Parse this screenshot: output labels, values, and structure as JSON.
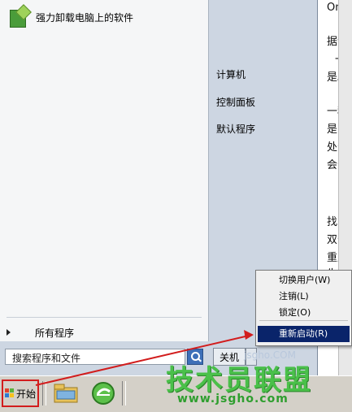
{
  "background_doc": {
    "lines": [
      {
        "text": "Oms么"
      },
      {
        "text": "据包"
      },
      {
        "text": "一般"
      },
      {
        "text": "是。"
      },
      {
        "text": "一种方"
      },
      {
        "text": "是 '"
      },
      {
        "text": "处分占"
      },
      {
        "text": "会影"
      },
      {
        "text": "找到"
      },
      {
        "text": "双击"
      },
      {
        "text": "重启"
      },
      {
        "text": "先任"
      }
    ]
  },
  "start_menu": {
    "pinned_program": "强力卸载电脑上的软件",
    "all_programs": "所有程序",
    "search_placeholder": "搜索程序和文件",
    "right_items": [
      "计算机",
      "控制面板",
      "默认程序"
    ],
    "shutdown_label": "关机"
  },
  "submenu": {
    "items": [
      "切换用户(W)",
      "注销(L)",
      "锁定(O)",
      "重新启动(R)"
    ],
    "highlighted": "重新启动(R)"
  },
  "taskbar": {
    "start_label": "开始"
  },
  "watermark": {
    "main": "技术员联盟",
    "sub": "www.jsgho.com",
    "faint": "jsgho.COM"
  },
  "colors": {
    "highlight": "#0a246a",
    "annotation_red": "#d21d1d",
    "watermark_green": "#3fbf3f"
  }
}
